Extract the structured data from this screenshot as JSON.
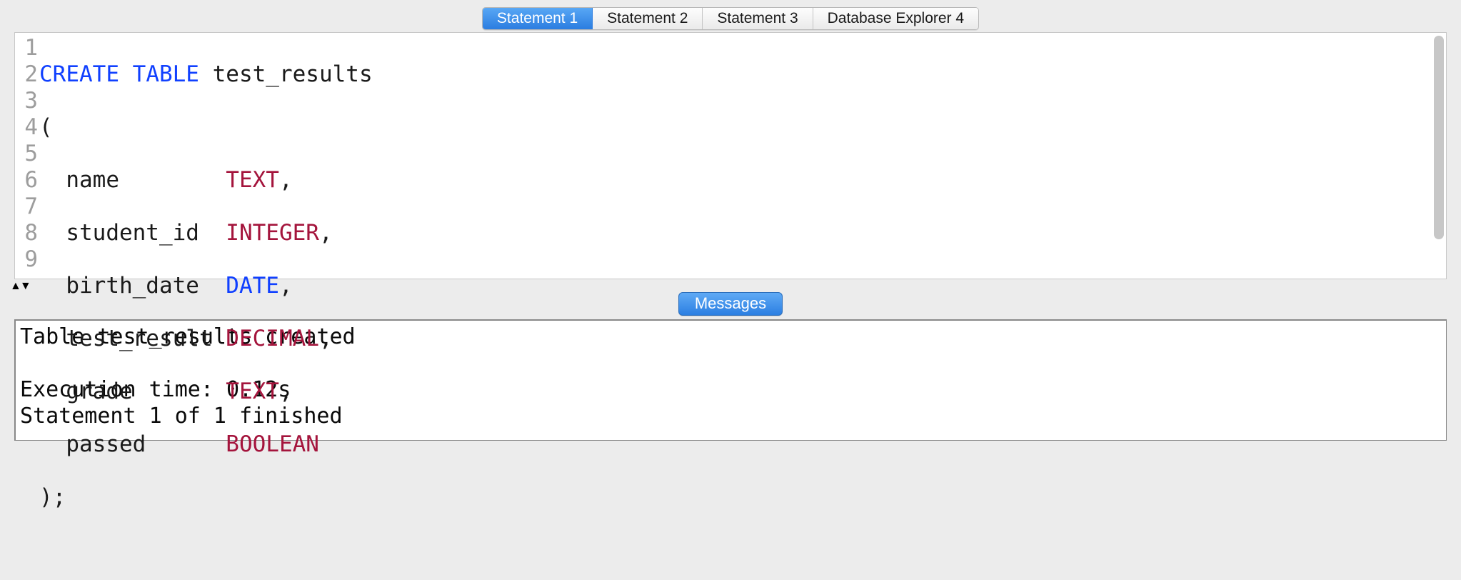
{
  "tabs": {
    "items": [
      {
        "label": "Statement 1",
        "active": true
      },
      {
        "label": "Statement 2",
        "active": false
      },
      {
        "label": "Statement 3",
        "active": false
      },
      {
        "label": "Database Explorer 4",
        "active": false
      }
    ]
  },
  "editor": {
    "line_count": 9,
    "lines": {
      "1": {
        "pre": "",
        "kw1": "CREATE",
        "sp1": " ",
        "kw2": "TABLE",
        "rest": " test_results"
      },
      "2": {
        "text": "("
      },
      "3": {
        "col": "  name        ",
        "type": "TEXT",
        "trail": ","
      },
      "4": {
        "col": "  student_id  ",
        "type": "INTEGER",
        "trail": ","
      },
      "5": {
        "col": "  birth_date  ",
        "type": "DATE",
        "trail": ","
      },
      "6": {
        "col": "  test_result ",
        "type": "DECIMAL",
        "trail": ","
      },
      "7": {
        "col": "  grade       ",
        "type": "TEXT",
        "trail": ","
      },
      "8": {
        "col": "  passed      ",
        "type": "BOOLEAN",
        "trail": ""
      },
      "9": {
        "text": ");"
      }
    }
  },
  "messages": {
    "tab_label": "Messages",
    "body": "Table test_results created\n\nExecution time: 0.12s\nStatement 1 of 1 finished"
  },
  "gutter": {
    "n1": "1",
    "n2": "2",
    "n3": "3",
    "n4": "4",
    "n5": "5",
    "n6": "6",
    "n7": "7",
    "n8": "8",
    "n9": "9"
  }
}
